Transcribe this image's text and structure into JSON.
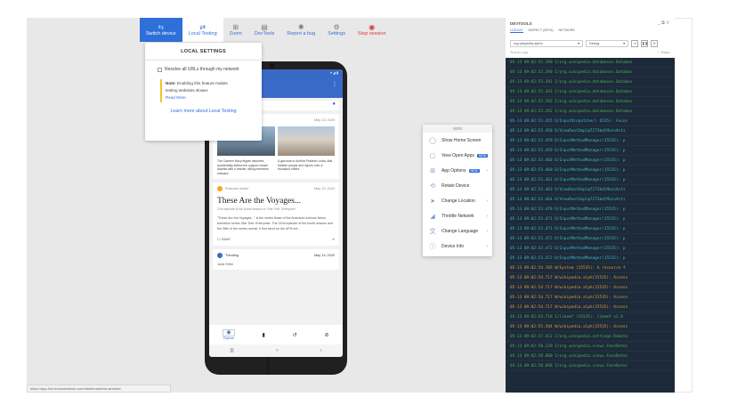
{
  "toolbar": {
    "items": [
      {
        "label": "Switch device",
        "icon": "switch-icon"
      },
      {
        "label": "Local Testing",
        "icon": "local-testing-icon"
      },
      {
        "label": "Zoom",
        "icon": "zoom-icon"
      },
      {
        "label": "DevTools",
        "icon": "devtools-icon"
      },
      {
        "label": "Report a bug",
        "icon": "bug-icon"
      },
      {
        "label": "Settings",
        "icon": "gear-icon"
      },
      {
        "label": "Stop session",
        "icon": "stop-icon"
      }
    ]
  },
  "local_settings": {
    "title": "LOCAL SETTINGS",
    "checkbox_label": "Resolve all URLs through my network",
    "note_bold": "Note:",
    "note_text": " Enabling this feature makes testing websites slower.",
    "read_more": "Read More",
    "learn_more": "Learn more about Local Testing"
  },
  "phone": {
    "status_left": "3:37",
    "status_right": "▾ ◢ ▮",
    "news_date": "May 13, 2020",
    "news_col1": "The Carmen Navy frigate assumes accidentally strikes the support vessel Atlantis with a missile, killing members onboard.",
    "news_col2": "A gas leak in Andhra Pradesh, India, kills thirteen people and injures over a thousand others.",
    "featured_label": "Featured article",
    "featured_date": "May 13, 2020",
    "featured_title": "These Are the Voyages...",
    "featured_sub": "23rd episode of the fourth season of \"Star Trek: Enterprise\"",
    "featured_body": "\"These Are the Voyages...\" is the series finale of the American science fiction television series Star Trek: Enterprise. The 22nd episode of the fourth season and the 98th of the series overall, it first aired on the UPN net...",
    "save_label": "SAVE",
    "trending_label": "Trending",
    "trending_date": "May 13, 2020",
    "trending_item": "Janis Triller",
    "nav_explore": "Explore"
  },
  "context_menu": {
    "title": "0000",
    "items": [
      {
        "label": "Show Home Screen",
        "icon": "home-icon",
        "badge": "",
        "chevron": false
      },
      {
        "label": "View Open Apps",
        "icon": "open-apps-icon",
        "badge": "NEW",
        "chevron": false
      },
      {
        "label": "App Options",
        "icon": "app-options-icon",
        "badge": "NEW",
        "chevron": true
      },
      {
        "label": "Rotate Device",
        "icon": "rotate-icon",
        "badge": "",
        "chevron": false
      },
      {
        "label": "Change Location",
        "icon": "location-icon",
        "badge": "",
        "chevron": true
      },
      {
        "label": "Throttle Network",
        "icon": "network-icon",
        "badge": "",
        "chevron": true
      },
      {
        "label": "Change Language",
        "icon": "language-icon",
        "badge": "",
        "chevron": true
      },
      {
        "label": "Device Info",
        "icon": "info-icon",
        "badge": "",
        "chevron": true
      }
    ]
  },
  "url_status": "https://app-live.browserstack.com/dashboard#os=android",
  "devtools": {
    "title": "DEVTOOLS",
    "tabs": [
      "LOGCAT",
      "INSPECT (BETA)",
      "NETWORK"
    ],
    "app_select": "org.wikipedia.alpha",
    "level_select": "Debug",
    "search_placeholder": "Search Logs",
    "regex_label": "Regex",
    "log_lines": [
      {
        "text": "05-13 09:02:53.390 I/org.wikipedia.databases.Databas",
        "color": "g"
      },
      {
        "text": "05-13 09:02:53.390 I/org.wikipedia.databases.Databas",
        "color": "g"
      },
      {
        "text": "05-13 09:02:53.391 I/org.wikipedia.databases.Databas",
        "color": "g"
      },
      {
        "text": "05-13 09:02:53.391 I/org.wikipedia.databases.Databas",
        "color": "g"
      },
      {
        "text": "05-13 09:02:53.392 I/org.wikipedia.databases.Databas",
        "color": "g"
      },
      {
        "text": "05-13 09:02:53.392 I/org.wikipedia.databases.Databas",
        "color": "g"
      },
      {
        "text": "05-13 09:02:53.455 D/InputDispatcher( 6535): Focus",
        "color": "c"
      },
      {
        "text": "05-13 09:02:53.458 D/ViewRootImpl@7273bd[MainActi",
        "color": "c"
      },
      {
        "text": "05-13 09:02:53.459 D/InputMethodManager(15535): p",
        "color": "c"
      },
      {
        "text": "05-13 09:02:53.459 D/InputMethodManager(15535): p",
        "color": "c"
      },
      {
        "text": "05-13 09:02:53.460 D/InputMethodManager(15535): p",
        "color": "c"
      },
      {
        "text": "05-13 09:02:53.460 D/InputMethodManager(15535): p",
        "color": "c"
      },
      {
        "text": "05-13 09:02:53.461 D/InputMethodManager(15535): p",
        "color": "c"
      },
      {
        "text": "05-13 09:02:53.463 D/ViewRootImpl@7273bd[MainActi",
        "color": "c"
      },
      {
        "text": "05-13 09:02:53.464 D/ViewRootImpl@7273bd[MainActi",
        "color": "c"
      },
      {
        "text": "05-13 09:02:53.470 D/InputMethodManager(15535): p",
        "color": "c"
      },
      {
        "text": "05-13 09:02:53.471 D/InputMethodManager(15535): p",
        "color": "c"
      },
      {
        "text": "05-13 09:02:53.471 D/InputMethodManager(15535): p",
        "color": "c"
      },
      {
        "text": "05-13 09:02:53.472 D/InputMethodManager(15535): p",
        "color": "c"
      },
      {
        "text": "05-13 09:02:53.472 D/InputMethodManager(15535): p",
        "color": "c"
      },
      {
        "text": "05-13 09:02:53.472 D/InputMethodManager(15535): p",
        "color": "c"
      },
      {
        "text": "05-13 09:02:54.705 W/System (15535): A resource f",
        "color": "o"
      },
      {
        "text": "05-13 09:02:54.717 W/wikipedia.alph(15535): Access",
        "color": "o"
      },
      {
        "text": "05-13 09:02:54.717 W/wikipedia.alph(15535): Access",
        "color": "o"
      },
      {
        "text": "05-13 09:02:54.717 W/wikipedia.alph(15535): Access",
        "color": "o"
      },
      {
        "text": "05-13 09:02:54.717 W/wikipedia.alph(15535): Access",
        "color": "o"
      },
      {
        "text": "05-13 09:02:54.718 I/libemf (15535): libemf v2.0",
        "color": "g"
      },
      {
        "text": "05-13 09:02:55.584 W/wikipedia.alph(15535): Access",
        "color": "o"
      },
      {
        "text": "05-13 09:02:57.411 I/org.wikipedia.settings.Remote",
        "color": "g"
      },
      {
        "text": "05-13 09:02:58.139 I/org.wikipedia.views.FaceDetec",
        "color": "g"
      },
      {
        "text": "05-13 09:02:58.800 I/org.wikipedia.views.FaceDetec",
        "color": "g"
      },
      {
        "text": "05-13 09:02:58.898 I/org.wikipedia.views.FaceDetec",
        "color": "g"
      }
    ]
  }
}
